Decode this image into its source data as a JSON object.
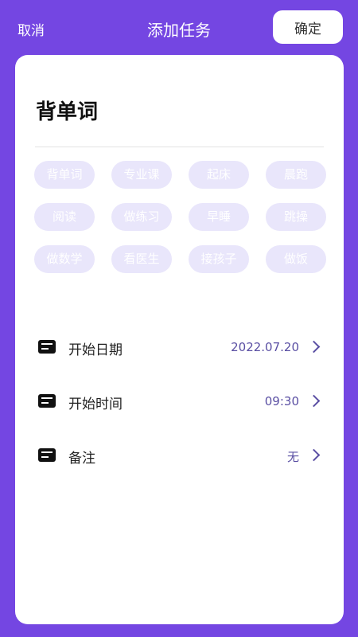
{
  "header": {
    "cancel_label": "取消",
    "title": "添加任务",
    "confirm_label": "确定"
  },
  "task": {
    "name": "背单词"
  },
  "tags": [
    "背单词",
    "专业课",
    "起床",
    "晨跑",
    "阅读",
    "做练习",
    "早睡",
    "跳操",
    "做数学",
    "看医生",
    "接孩子",
    "做饭"
  ],
  "rows": [
    {
      "label": "开始日期",
      "value": "2022.07.20"
    },
    {
      "label": "开始时间",
      "value": "09:30"
    },
    {
      "label": "备注",
      "value": "无"
    }
  ],
  "colors": {
    "accent": "#7446e2",
    "tag_background": "#e9e6fb",
    "value_text": "#5a4fa3"
  }
}
